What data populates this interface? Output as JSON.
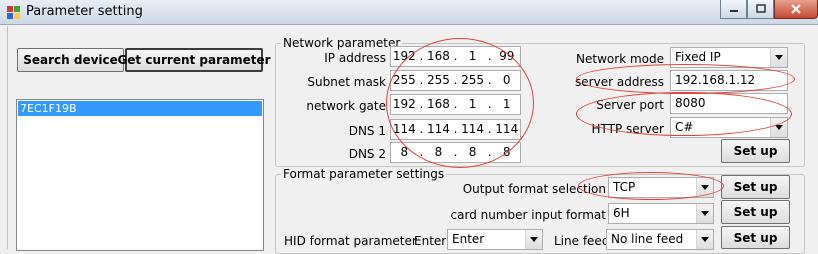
{
  "window": {
    "title": "Parameter setting"
  },
  "toolbar": {
    "search_label": "Search device",
    "get_param_label": "Get current parameter"
  },
  "device_list": {
    "items": [
      "7EC1F19B"
    ]
  },
  "network": {
    "legend": "Network parameter",
    "ip_label": "IP address",
    "ip": [
      "192",
      "168",
      "1",
      "99"
    ],
    "mask_label": "Subnet mask",
    "mask": [
      "255",
      "255",
      "255",
      "0"
    ],
    "gate_label": "network gate",
    "gate": [
      "192",
      "168",
      "1",
      "1"
    ],
    "dns1_label": "DNS 1",
    "dns1": [
      "114",
      "114",
      "114",
      "114"
    ],
    "dns2_label": "DNS 2",
    "dns2": [
      "8",
      "8",
      "8",
      "8"
    ],
    "mode_label": "Network mode",
    "mode_value": "Fixed IP",
    "server_addr_label": "server address",
    "server_addr": "192.168.1.12",
    "server_port_label": "Server port",
    "server_port": "8080",
    "http_label": "HTTP server",
    "http_value": "C#",
    "setup_label": "Set up"
  },
  "format": {
    "legend": "Format parameter settings",
    "output_label": "Output format selection",
    "output_value": "TCP",
    "card_label": "card number input format",
    "card_value": "6H",
    "hid_label": "HID format parameter",
    "enter_label": "Enter",
    "enter_value": "Enter",
    "linefeed_label": "Line feed",
    "linefeed_value": "No line feed",
    "setup_label": "Set up"
  }
}
